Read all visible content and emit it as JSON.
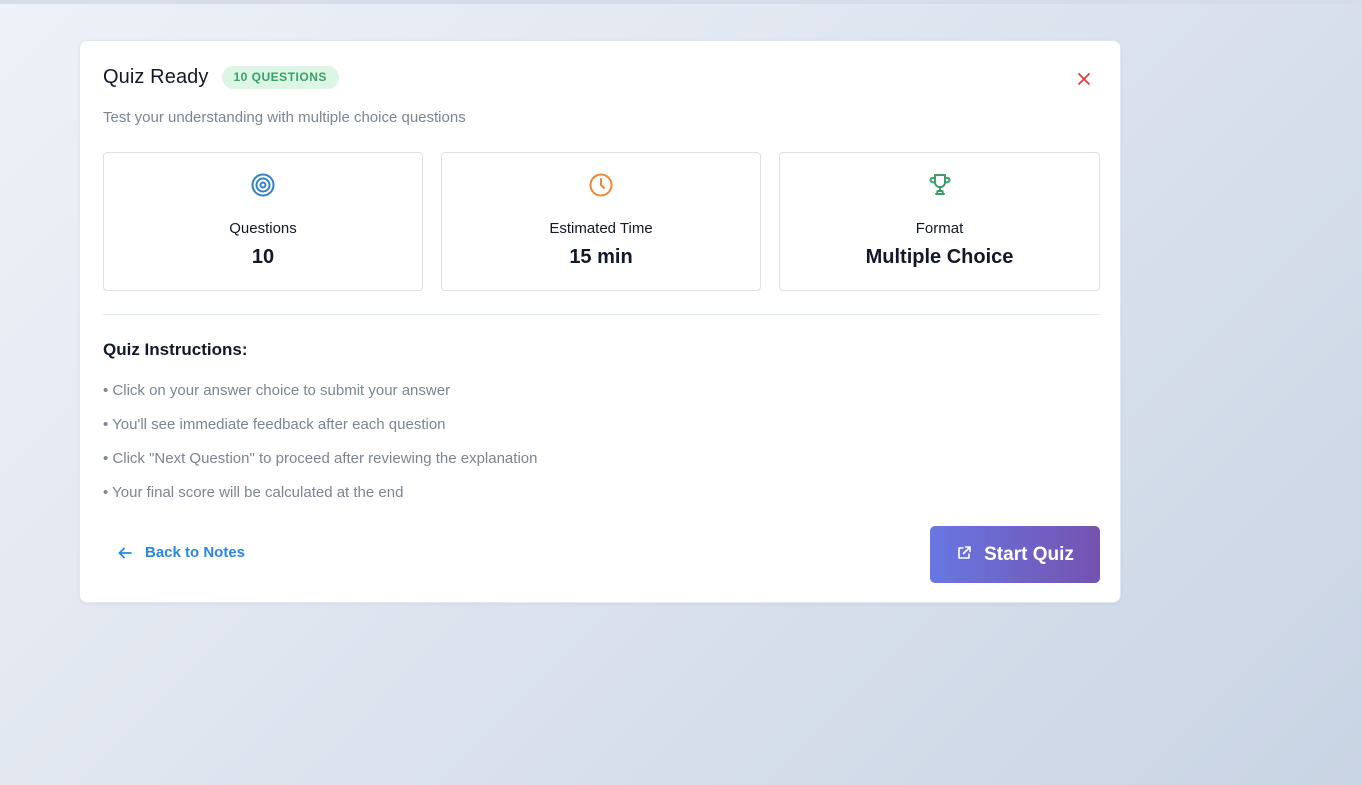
{
  "header": {
    "title": "Quiz Ready",
    "badge": "10 QUESTIONS",
    "subtitle": "Test your understanding with multiple choice questions",
    "close_icon": "close-icon"
  },
  "stats": [
    {
      "icon": "target-icon",
      "label": "Questions",
      "value": "10",
      "color": "#3182ce"
    },
    {
      "icon": "clock-icon",
      "label": "Estimated Time",
      "value": "15 min",
      "color": "#ed8936"
    },
    {
      "icon": "trophy-icon",
      "label": "Format",
      "value": "Multiple Choice",
      "color": "#38a169"
    }
  ],
  "instructions": {
    "title": "Quiz Instructions:",
    "items": [
      "• Click on your answer choice to submit your answer",
      "• You'll see immediate feedback after each question",
      "• Click \"Next Question\" to proceed after reviewing the explanation",
      "• Your final score will be calculated at the end"
    ]
  },
  "actions": {
    "back_label": "Back to Notes",
    "back_icon": "arrow-left-icon",
    "start_label": "Start Quiz",
    "start_icon": "external-link-icon"
  },
  "colors": {
    "badge_bg": "#dcf5e4",
    "badge_text": "#38a169",
    "close": "#e53e3e",
    "link": "#2b87d8",
    "start_gradient_from": "#6877e2",
    "start_gradient_to": "#7552b0"
  }
}
